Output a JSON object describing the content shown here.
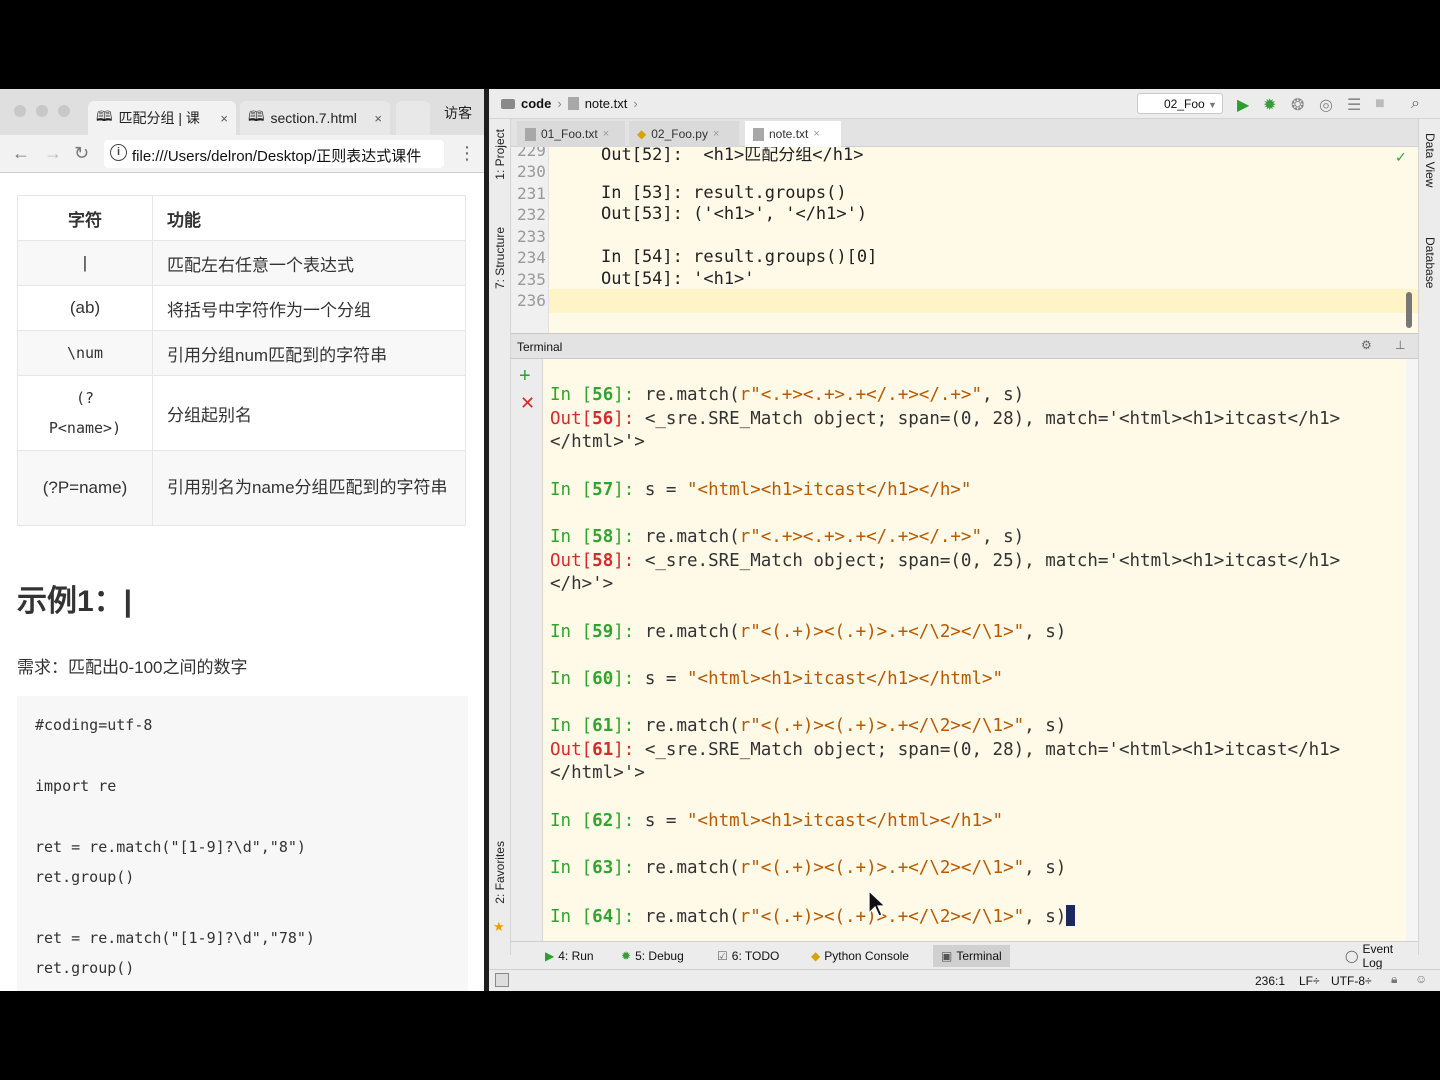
{
  "browser": {
    "tabs": [
      {
        "title": "匹配分组 | 课"
      },
      {
        "title": "section.7.html"
      }
    ],
    "visitor": "访客",
    "url": "file:///Users/delron/Desktop/正则表达式课件",
    "table": {
      "headers": [
        "字符",
        "功能"
      ],
      "rows": [
        {
          "char": "|",
          "desc": "匹配左右任意一个表达式"
        },
        {
          "char": "(ab)",
          "desc": "将括号中字符作为一个分组"
        },
        {
          "char": "\\num",
          "desc": "引用分组num匹配到的字符串"
        },
        {
          "char": "(?P<name>)",
          "desc": "分组起别名"
        },
        {
          "char": "(?P=name)",
          "desc": "引用别名为name分组匹配到的字符串"
        }
      ]
    },
    "example_title": "示例1：|",
    "requirement": "需求：匹配出0-100之间的数字",
    "code": [
      "#coding=utf-8",
      "import re",
      "ret = re.match(\"[1-9]?\\d\",\"8\")",
      "ret.group()",
      "ret = re.match(\"[1-9]?\\d\",\"78\")",
      "ret.group()"
    ]
  },
  "ide": {
    "breadcrumb": [
      "code",
      "note.txt"
    ],
    "run_config": "02_Foo",
    "left_tools": [
      "1: Project",
      "7: Structure",
      "2: Favorites"
    ],
    "right_tools": [
      "Data View",
      "Database"
    ],
    "editor_tabs": [
      "01_Foo.txt",
      "02_Foo.py",
      "note.txt"
    ],
    "editor_lines": [
      {
        "num": "229",
        "text": "Out[52]:  <h1>匹配分组</h1>"
      },
      {
        "num": "230",
        "text": ""
      },
      {
        "num": "231",
        "text": "In [53]: result.groups()"
      },
      {
        "num": "232",
        "text": "Out[53]: ('<h1>', '</h1>')"
      },
      {
        "num": "233",
        "text": ""
      },
      {
        "num": "234",
        "text": "In [54]: result.groups()[0]"
      },
      {
        "num": "235",
        "text": "Out[54]: '<h1>'"
      },
      {
        "num": "236",
        "text": ""
      }
    ],
    "terminal_title": "Terminal",
    "terminal": {
      "l56_in": "In [56]: re.match(r\"<.+><.+>.+</.+></.+>\", s)",
      "l56_out": "Out[56]: <_sre.SRE_Match object; span=(0, 28), match='<html><h1>itcast</h1>",
      "l56_out2": "</html>'>",
      "l57_in": "In [57]: s = \"<html><h1>itcast</h1></h>\"",
      "l58_in": "In [58]: re.match(r\"<.+><.+>.+</.+></.+>\", s)",
      "l58_out": "Out[58]: <_sre.SRE_Match object; span=(0, 25), match='<html><h1>itcast</h1>",
      "l58_out2": "</h>'>",
      "l59_in": "In [59]: re.match(r\"<(.+)><(.+)>.+</\\2></\\1>\", s)",
      "l60_in": "In [60]: s = \"<html><h1>itcast</h1></html>\"",
      "l61_in": "In [61]: re.match(r\"<(.+)><(.+)>.+</\\2></\\1>\", s)",
      "l61_out": "Out[61]: <_sre.SRE_Match object; span=(0, 28), match='<html><h1>itcast</h1>",
      "l61_out2": "</html>'>",
      "l62_in": "In [62]: s = \"<html><h1>itcast</html></h1>\"",
      "l63_in": "In [63]: re.match(r\"<(.+)><(.+)>.+</\\2></\\1>\", s)",
      "l64_in": "In [64]: re.match(r\"<(.+)><(.+)>.+</\\2></\\1>\", s)"
    },
    "tool_windows": [
      "4: Run",
      "5: Debug",
      "6: TODO",
      "Python Console",
      "Terminal"
    ],
    "event_log": "Event Log",
    "status": {
      "position": "236:1",
      "line_sep": "LF÷",
      "encoding": "UTF-8÷"
    }
  },
  "colors": {
    "prompt_in": "#2fa52f",
    "prompt_out": "#d42a2a",
    "string": "#b75a00",
    "terminal_bg": "#fff9e8"
  }
}
